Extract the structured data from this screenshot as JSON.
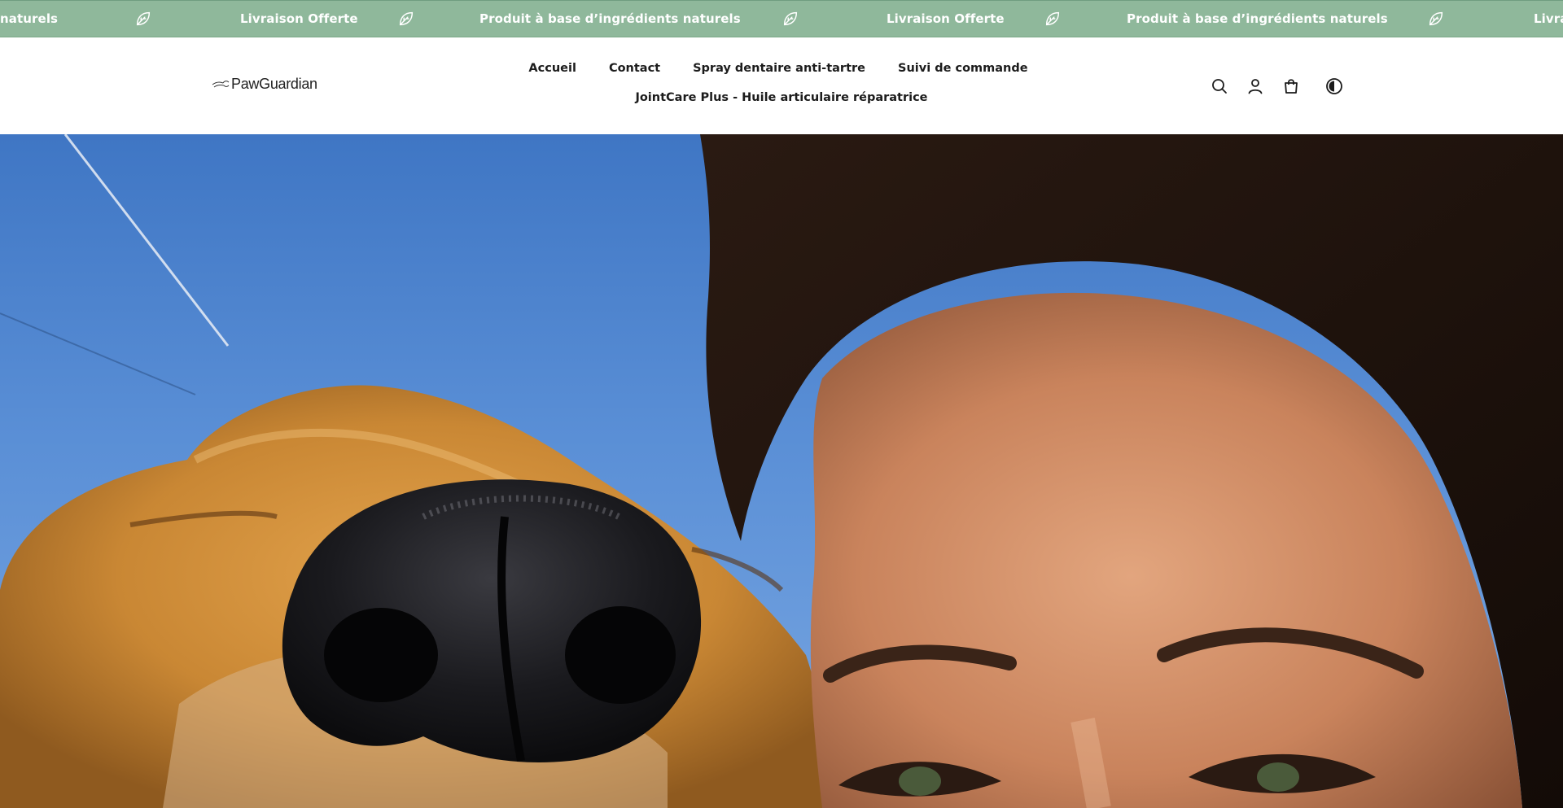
{
  "announcement": {
    "background": "#8fb89b",
    "messages": [
      "naturels",
      "Livraison Offerte",
      "Produit à base d’ingrédients naturels",
      "Livraison Offerte",
      "Produit à base d’ingrédients naturels",
      "Livrai"
    ],
    "separator_icon": "leaf-icon"
  },
  "header": {
    "logo_text": "PawGuardian",
    "logo_icon": "paw-wing-logo",
    "nav": [
      {
        "label": "Accueil"
      },
      {
        "label": "Contact"
      },
      {
        "label": "Spray dentaire anti-tartre"
      },
      {
        "label": "Suivi de commande"
      },
      {
        "label": "JointCare Plus - Huile articulaire réparatrice"
      }
    ],
    "icons": [
      "search-icon",
      "account-icon",
      "cart-icon",
      "contrast-icon"
    ]
  },
  "hero": {
    "image": "close-up selfie of a golden dog nose beside a smiling woman under a blue sky"
  }
}
